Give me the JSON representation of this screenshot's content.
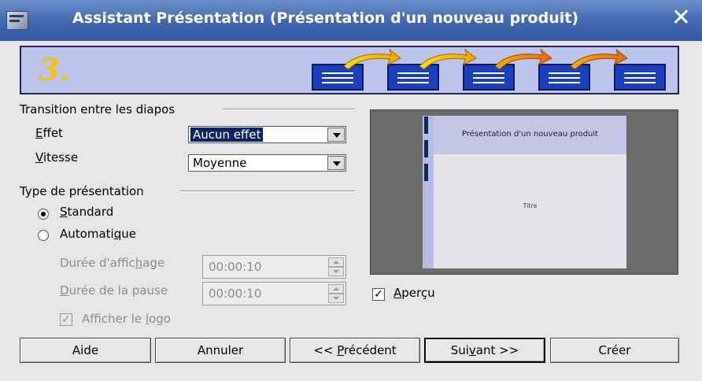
{
  "window": {
    "title": "Assistant Présentation (Présentation d'un nouveau produit)",
    "close_icon": "close-icon"
  },
  "banner": {
    "step": "3.",
    "icons": "slides-sequence-icon"
  },
  "transition": {
    "section_label": "Transition entre les diapos",
    "effect_label": "Effet",
    "effect_value": "Aucun effet",
    "speed_label": "Vitesse",
    "speed_value": "Moyenne"
  },
  "presentation_type": {
    "section_label": "Type de présentation",
    "standard_label": "Standard",
    "standard_selected": true,
    "auto_label": "Automatique",
    "auto_selected": false,
    "display_duration_label": "Durée d'affichage",
    "display_duration_value": "00:00:10",
    "pause_duration_label": "Durée de la pause",
    "pause_duration_value": "00:00:10",
    "show_logo_label": "Afficher le logo",
    "show_logo_checked": true
  },
  "preview": {
    "slide_title": "Présentation d'un nouveau produit",
    "slide_subtitle": "Titre",
    "checkbox_label": "Aperçu",
    "checkbox_checked": true
  },
  "buttons": {
    "help": "Aide",
    "cancel": "Annuler",
    "previous": "<< Précédent",
    "next": "Suivant >>",
    "create": "Créer"
  }
}
